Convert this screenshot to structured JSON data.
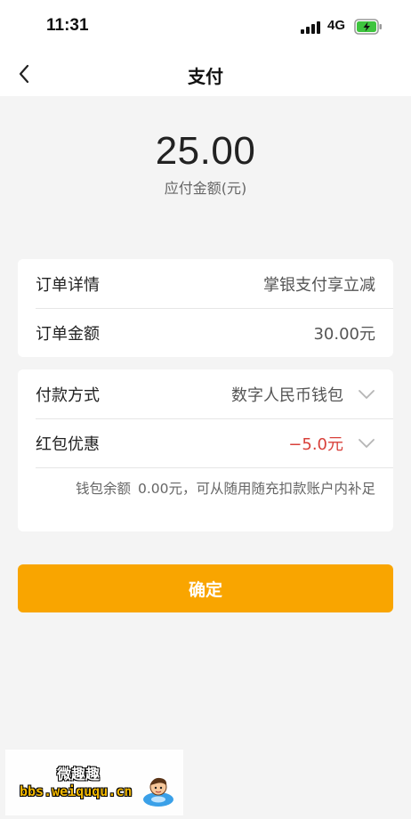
{
  "status_bar": {
    "time": "11:31",
    "network": "4G",
    "battery_state": "charging"
  },
  "nav": {
    "title": "支付",
    "back_icon": "chevron-left-icon"
  },
  "amount": {
    "value": "25.00",
    "label": "应付金额(元)"
  },
  "order_card": {
    "rows": [
      {
        "label": "订单详情",
        "value": "掌银支付享立减"
      },
      {
        "label": "订单金额",
        "value": "30.00元"
      }
    ]
  },
  "payment_card": {
    "method": {
      "label": "付款方式",
      "value": "数字人民币钱包"
    },
    "discount": {
      "label": "红包优惠",
      "value": "−5.0元",
      "color": "#d8403a"
    },
    "balance": {
      "label": "钱包余额",
      "text": "0.00元，可从随用随充扣款账户内补足"
    }
  },
  "confirm_label": "确定",
  "watermark": {
    "title": "微趣趣",
    "url": "bbs.weiququ.cn"
  },
  "colors": {
    "accent": "#f9a500",
    "discount_red": "#d8403a",
    "background": "#f4f4f4"
  }
}
